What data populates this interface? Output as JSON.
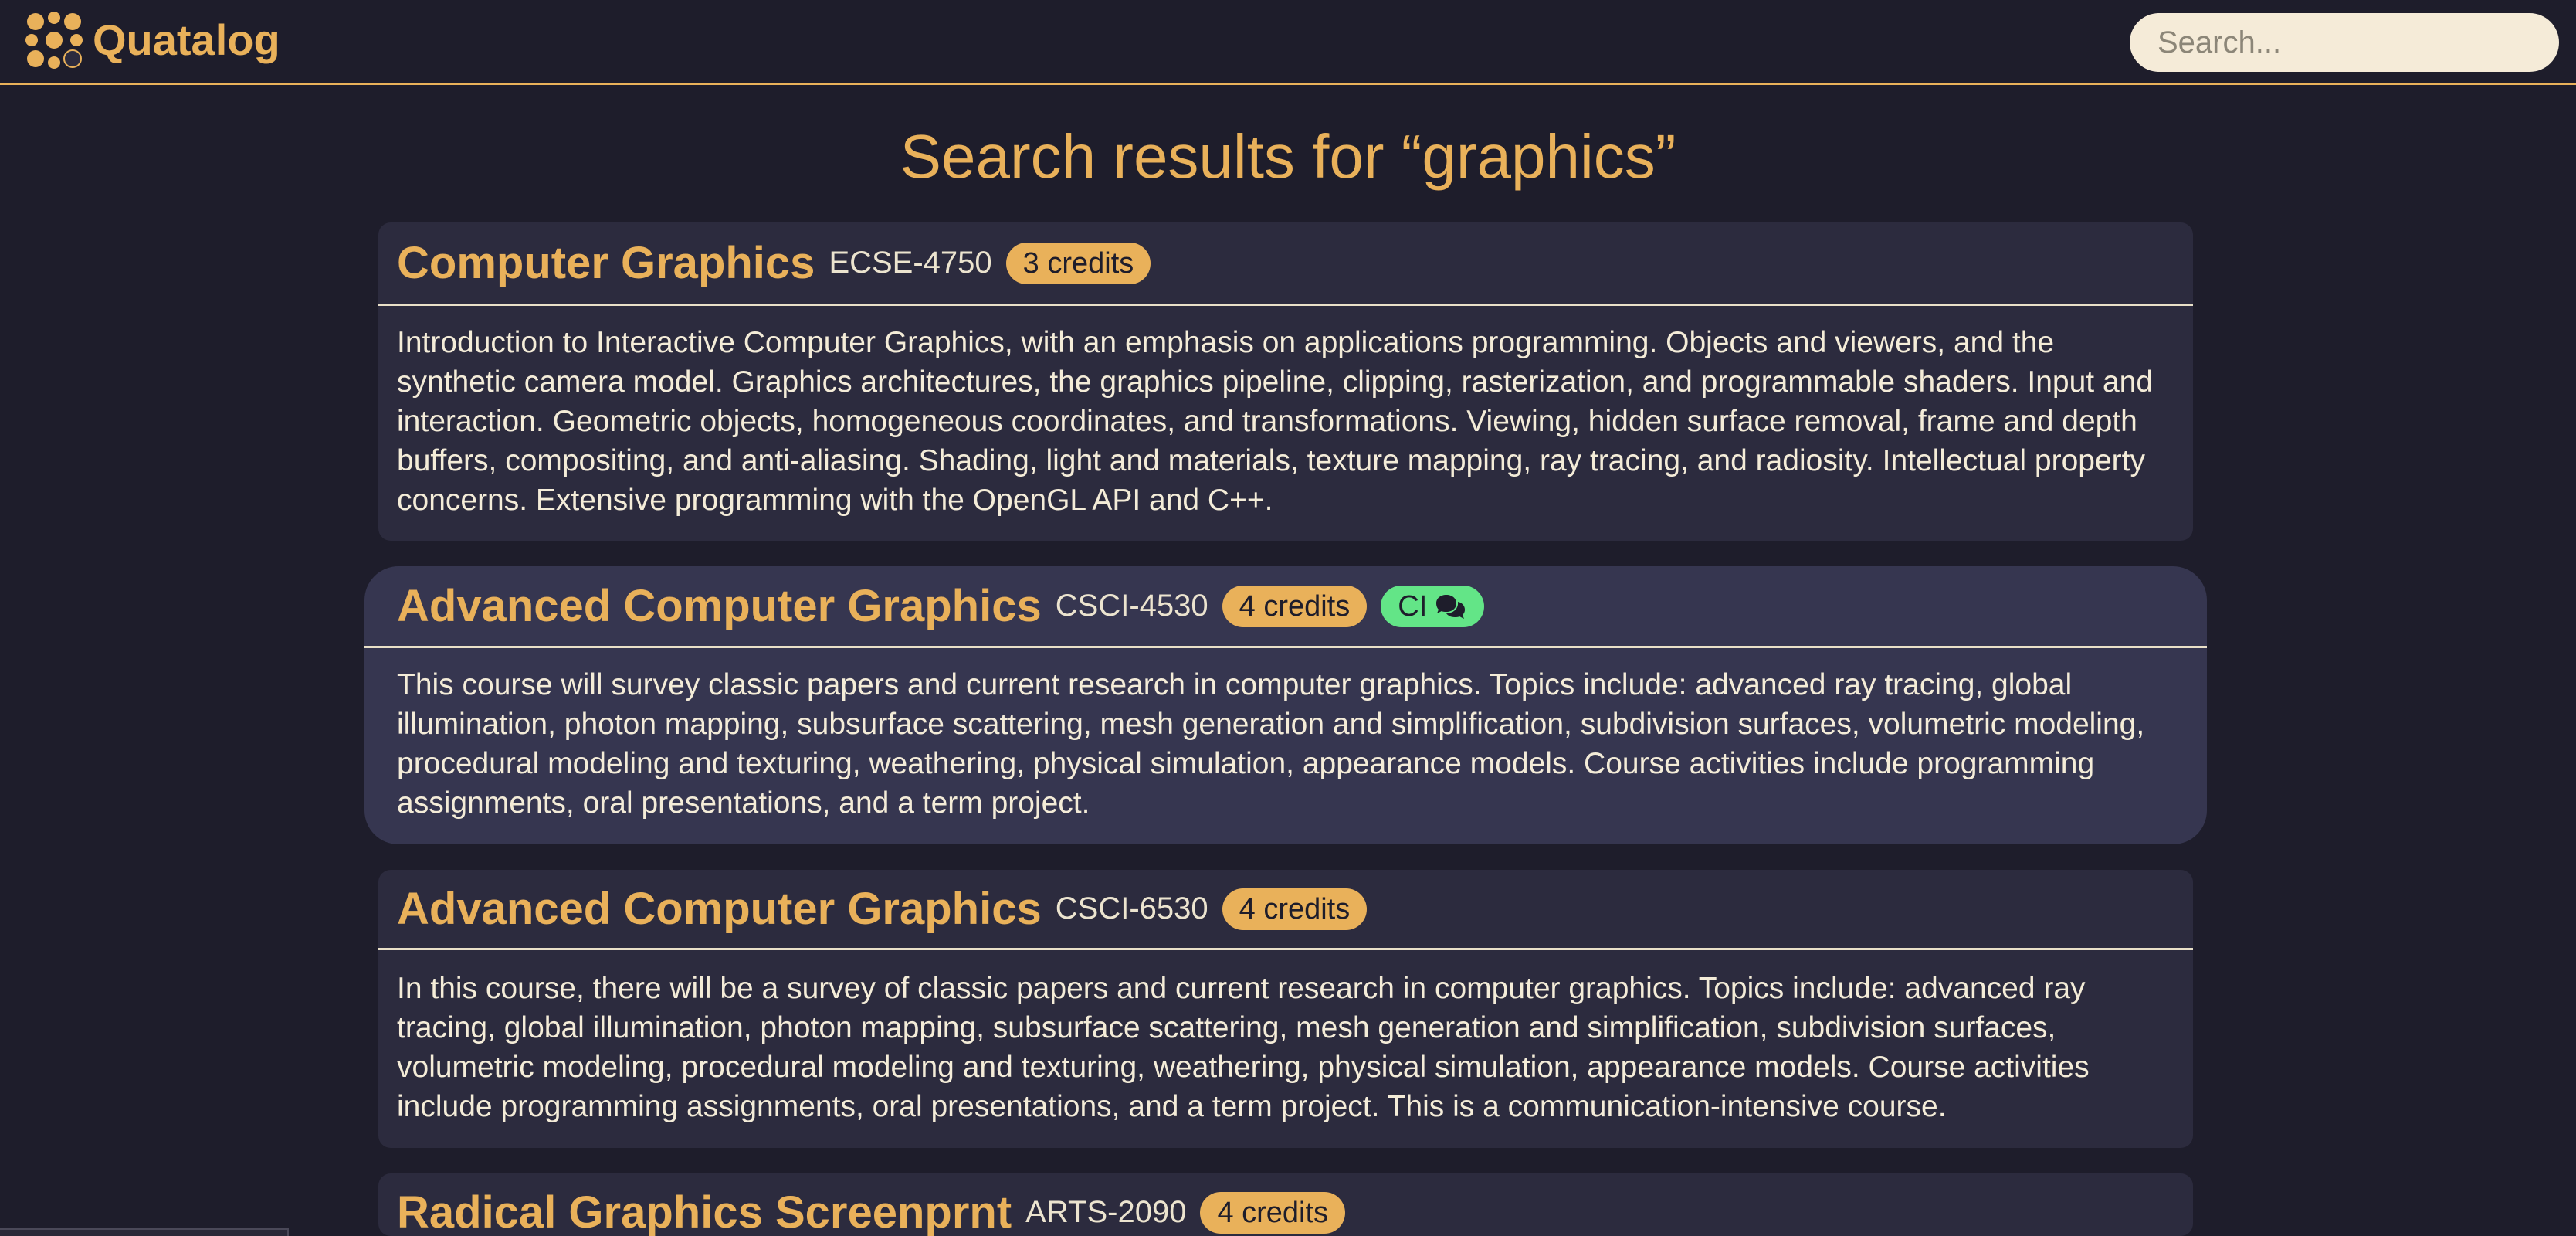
{
  "header": {
    "app_name": "Quatalog",
    "search_placeholder": "Search...",
    "search_value": ""
  },
  "page": {
    "title": "Search results for “graphics”"
  },
  "colors": {
    "background": "#1e1d2b",
    "accent": "#e9b15a",
    "card": "#2c2b3e",
    "card_highlight": "#363650",
    "ci_badge": "#63e587",
    "text": "#f4ecd8"
  },
  "results": [
    {
      "title": "Computer Graphics",
      "code": "ECSE-4750",
      "credits": "3 credits",
      "description": "Introduction to Interactive Computer Graphics, with an emphasis on applications programming. Objects and viewers, and the synthetic camera model. Graphics architectures, the graphics pipeline, clipping, rasterization, and programmable shaders. Input and interaction. Geometric objects, homogeneous coordinates, and transformations. Viewing, hidden surface removal, frame and depth buffers, compositing, and anti-aliasing. Shading, light and materials, texture mapping, ray tracing, and radiosity. Intellectual property concerns. Extensive programming with the OpenGL API and C++."
    },
    {
      "title": "Advanced Computer Graphics",
      "code": "CSCI-4530",
      "credits": "4 credits",
      "ci_label": "CI",
      "ci_icon": "comments-icon",
      "description": "This course will survey classic papers and current research in computer graphics. Topics include: advanced ray tracing, global illumination, photon mapping, subsurface scattering, mesh generation and simplification, subdivision surfaces, volumetric modeling, procedural modeling and texturing, weathering, physical simulation, appearance models. Course activities include programming assignments, oral presentations, and a term project."
    },
    {
      "title": "Advanced Computer Graphics",
      "code": "CSCI-6530",
      "credits": "4 credits",
      "description": "In this course, there will be a survey of classic papers and current research in computer graphics. Topics include: advanced ray tracing, global illumination, photon mapping, subsurface scattering, mesh generation and simplification, subdivision surfaces, volumetric modeling, procedural modeling and texturing, weathering, physical simulation, appearance models. Course activities include programming assignments, oral presentations, and a term project. This is a communication-intensive course."
    },
    {
      "title": "Radical Graphics Screenprnt",
      "code": "ARTS-2090",
      "credits": "4 credits"
    }
  ]
}
